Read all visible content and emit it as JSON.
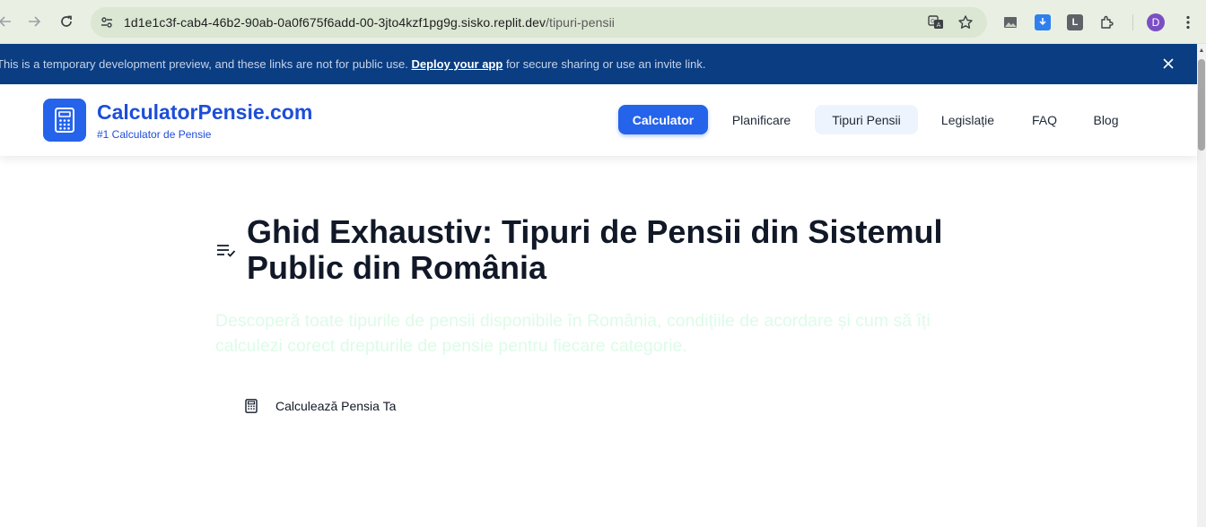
{
  "browser": {
    "url_host": "1d1e1c3f-cab4-46b2-90ab-0a0f675f6add-00-3jto4kzf1pg9g.sisko.replit.dev",
    "url_path": "/tipuri-pensii",
    "profile_initial": "D",
    "extension_letter": "L"
  },
  "banner": {
    "text_before": "This is a temporary development preview, and these links are not for public use. ",
    "link": "Deploy your app",
    "text_after": " for secure sharing or use an invite link."
  },
  "header": {
    "brand": "CalculatorPensie.com",
    "tagline": "#1 Calculator de Pensie",
    "nav": [
      {
        "label": "Calculator"
      },
      {
        "label": "Planificare"
      },
      {
        "label": "Tipuri Pensii"
      },
      {
        "label": "Legislație"
      },
      {
        "label": "FAQ"
      },
      {
        "label": "Blog"
      }
    ]
  },
  "hero": {
    "title": "Ghid Exhaustiv: Tipuri de Pensii din Sistemul Public din România",
    "subtitle": "Descoperă toate tipurile de pensii disponibile în România, condițiile de acordare și cum să îți calculezi corect drepturile de pensie pentru fiecare categorie.",
    "cta": "Calculează Pensia Ta"
  },
  "colors": {
    "primary": "#2563eb",
    "banner": "#0a3d82",
    "subtitle": "#dcfce7"
  }
}
